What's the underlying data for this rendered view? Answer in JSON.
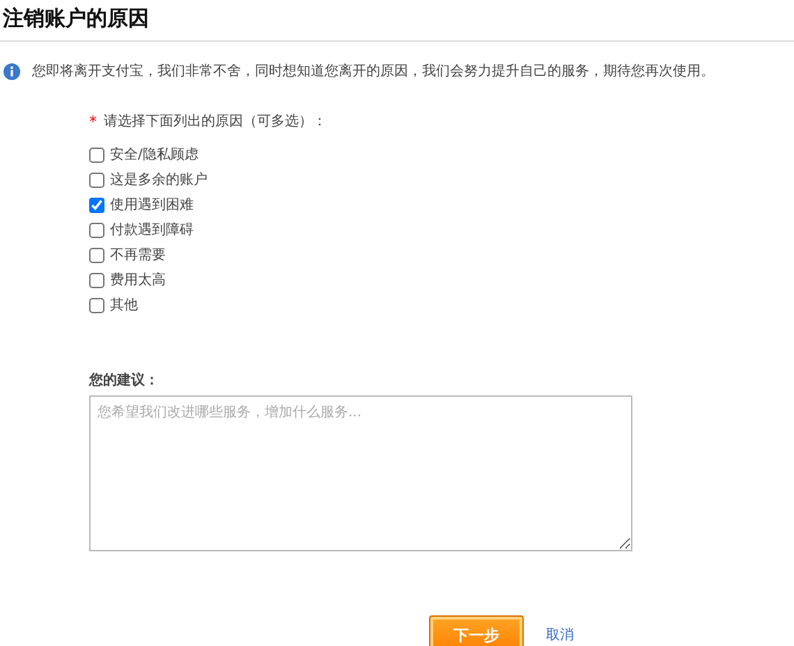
{
  "title": "注销账户的原因",
  "notice": "您即将离开支付宝，我们非常不舍，同时想知道您离开的原因，我们会努力提升自己的服务，期待您再次使用。",
  "reasons": {
    "required_mark": "*",
    "label": "请选择下面列出的原因（可多选）：",
    "options": [
      {
        "label": "安全/隐私顾虑",
        "checked": false
      },
      {
        "label": "这是多余的账户",
        "checked": false
      },
      {
        "label": "使用遇到困难",
        "checked": true
      },
      {
        "label": "付款遇到障碍",
        "checked": false
      },
      {
        "label": "不再需要",
        "checked": false
      },
      {
        "label": "费用太高",
        "checked": false
      },
      {
        "label": "其他",
        "checked": false
      }
    ]
  },
  "suggestion": {
    "label": "您的建议：",
    "placeholder": "您希望我们改进哪些服务，增加什么服务..."
  },
  "buttons": {
    "next": "下一步",
    "cancel": "取消"
  }
}
